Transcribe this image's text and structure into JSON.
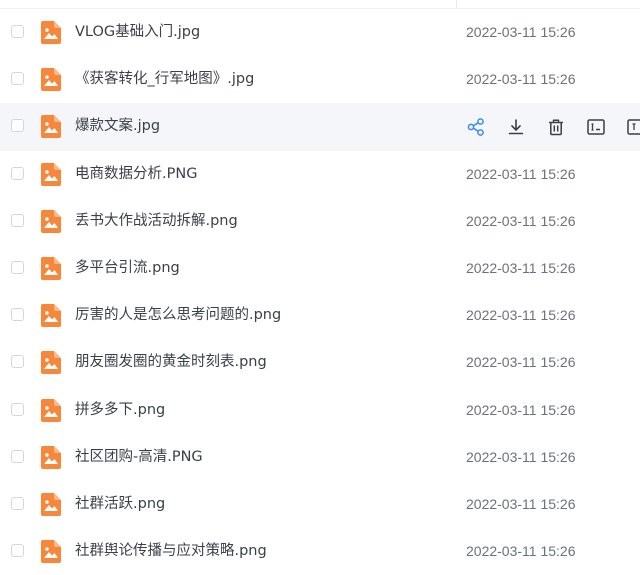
{
  "files": [
    {
      "name": "VLOG基础入门.jpg",
      "date": "2022-03-11 15:26"
    },
    {
      "name": "《获客转化_行军地图》.jpg",
      "date": "2022-03-11 15:26"
    },
    {
      "name": "爆款文案.jpg",
      "date": "",
      "hovered": true
    },
    {
      "name": "电商数据分析.PNG",
      "date": "2022-03-11 15:26"
    },
    {
      "name": "丢书大作战活动拆解.png",
      "date": "2022-03-11 15:26"
    },
    {
      "name": "多平台引流.png",
      "date": "2022-03-11 15:26"
    },
    {
      "name": "厉害的人是怎么思考问题的.png",
      "date": "2022-03-11 15:26"
    },
    {
      "name": "朋友圈发圈的黄金时刻表.png",
      "date": "2022-03-11 15:26"
    },
    {
      "name": "拼多多下.png",
      "date": "2022-03-11 15:26"
    },
    {
      "name": "社区团购-高清.PNG",
      "date": "2022-03-11 15:26"
    },
    {
      "name": "社群活跃.png",
      "date": "2022-03-11 15:26"
    },
    {
      "name": "社群舆论传播与应对策略.png",
      "date": "2022-03-11 15:26"
    }
  ],
  "hover_actions": [
    "share-icon",
    "download-icon",
    "delete-icon",
    "rename-icon",
    "move-icon"
  ],
  "colors": {
    "accent": "#3b8cf5",
    "file_icon": "#f7873a",
    "hover_row": "#f5f6fa"
  }
}
